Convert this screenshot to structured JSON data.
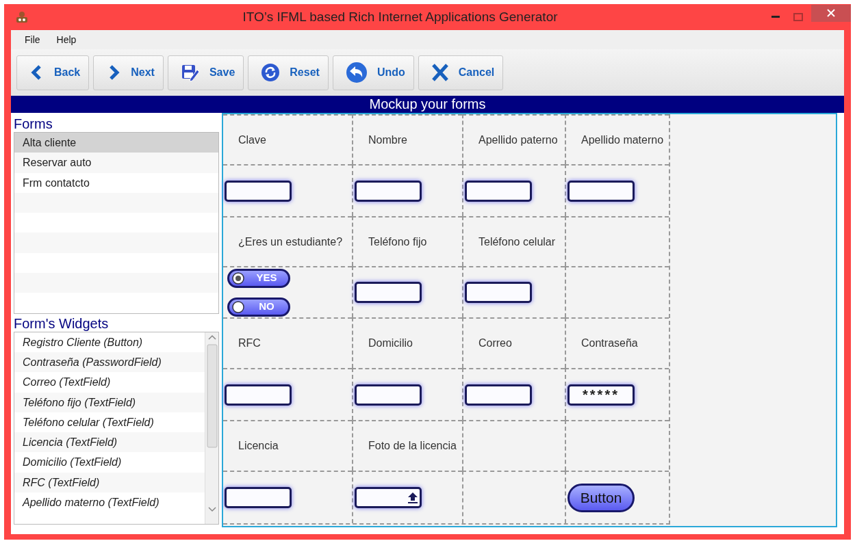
{
  "window": {
    "title": "ITO’s IFML based Rich Internet Applications Generator"
  },
  "menu": [
    "File",
    "Help"
  ],
  "toolbar": [
    {
      "label": "Back",
      "kind": "back"
    },
    {
      "label": "Next",
      "kind": "next"
    },
    {
      "label": "Save",
      "kind": "save"
    },
    {
      "label": "Reset",
      "kind": "reset"
    },
    {
      "label": "Undo",
      "kind": "undo"
    },
    {
      "label": "Cancel",
      "kind": "cancel"
    }
  ],
  "header": "Mockup your forms",
  "forms": {
    "title": "Forms",
    "items": [
      {
        "label": "Alta cliente",
        "selected": true
      },
      {
        "label": "Reservar auto",
        "selected": false
      },
      {
        "label": "Frm contatcto",
        "selected": false
      }
    ]
  },
  "widgets": {
    "title": "Form's Widgets",
    "items": [
      "Registro Cliente (Button)",
      "Contraseña (PasswordField)",
      "Correo (TextField)",
      "Teléfono fijo (TextField)",
      "Teléfono celular (TextField)",
      "Licencia (TextField)",
      "Domicilio (TextField)",
      "RFC (TextField)",
      "Apellido materno (TextField)"
    ]
  },
  "grid": [
    [
      {
        "kind": "label",
        "text": "Clave"
      },
      {
        "kind": "label",
        "text": "Nombre"
      },
      {
        "kind": "label",
        "text": "Apellido paterno"
      },
      {
        "kind": "label",
        "text": "Apellido materno"
      }
    ],
    [
      {
        "kind": "textfield"
      },
      {
        "kind": "textfield"
      },
      {
        "kind": "textfield"
      },
      {
        "kind": "textfield"
      }
    ],
    [
      {
        "kind": "label",
        "text": "¿Eres un estudiante?"
      },
      {
        "kind": "label",
        "text": "Teléfono fijo"
      },
      {
        "kind": "label",
        "text": "Teléfono celular"
      },
      {
        "kind": "empty"
      }
    ],
    [
      {
        "kind": "radio",
        "options": [
          {
            "label": "YES",
            "selected": true
          },
          {
            "label": "NO",
            "selected": false
          }
        ]
      },
      {
        "kind": "textfield"
      },
      {
        "kind": "textfield"
      },
      {
        "kind": "empty"
      }
    ],
    [
      {
        "kind": "label",
        "text": "RFC"
      },
      {
        "kind": "label",
        "text": "Domicilio"
      },
      {
        "kind": "label",
        "text": "Correo"
      },
      {
        "kind": "label",
        "text": "Contraseña"
      }
    ],
    [
      {
        "kind": "textfield"
      },
      {
        "kind": "textfield"
      },
      {
        "kind": "textfield"
      },
      {
        "kind": "password",
        "value": "*****"
      }
    ],
    [
      {
        "kind": "label",
        "text": "Licencia"
      },
      {
        "kind": "label",
        "text": "Foto de la licencia"
      },
      {
        "kind": "empty"
      },
      {
        "kind": "empty"
      }
    ],
    [
      {
        "kind": "textfield"
      },
      {
        "kind": "file"
      },
      {
        "kind": "empty"
      },
      {
        "kind": "button",
        "label": "Button"
      }
    ]
  ]
}
